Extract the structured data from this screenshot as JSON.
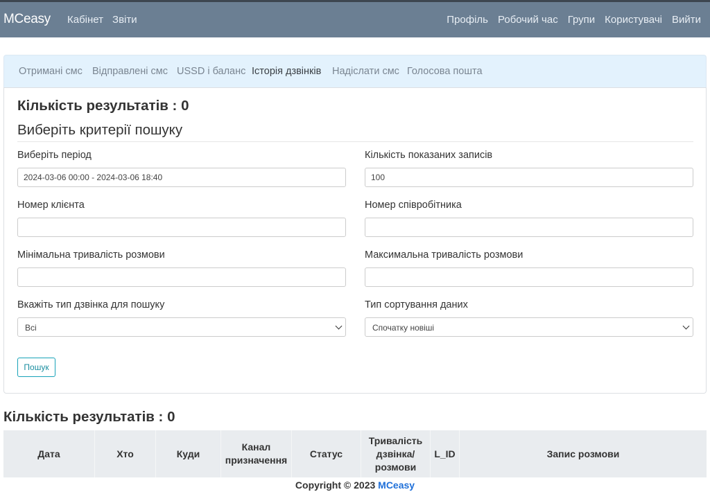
{
  "navbar": {
    "brand": "MCeasy",
    "left_links": [
      "Кабінет",
      "Звіти"
    ],
    "right_links": [
      "Профіль",
      "Робочий час",
      "Групи",
      "Користувачі",
      "Вийти"
    ]
  },
  "tabs": [
    {
      "label": "Отримані смс",
      "active": false
    },
    {
      "label": "Відправлені смс",
      "active": false
    },
    {
      "label": "USSD і баланс",
      "active": false
    },
    {
      "label": "Історія дзвінків",
      "active": true
    },
    {
      "label": "Надіслати смс",
      "active": false
    },
    {
      "label": "Голосова пошта",
      "active": false
    }
  ],
  "form": {
    "results_count": "Кількість результатів : 0",
    "criteria_title": "Виберіть критерії пошуку",
    "period_label": "Виберіть період",
    "period_value": "2024-03-06 00:00 - 2024-03-06 18:40",
    "records_label": "Кількість показаних записів",
    "records_value": "100",
    "client_label": "Номер клієнта",
    "client_value": "",
    "employee_label": "Номер співробітника",
    "employee_value": "",
    "min_duration_label": "Мінімальна тривалість розмови",
    "min_duration_value": "",
    "max_duration_label": "Максимальна тривалість розмови",
    "max_duration_value": "",
    "call_type_label": "Вкажіть тип дзвінка для пошуку",
    "call_type_value": "Всі",
    "sort_label": "Тип сортування даних",
    "sort_value": "Спочатку новіші",
    "search_button": "Пошук"
  },
  "results": {
    "count_title": "Кількість результатів : 0",
    "columns": [
      "Дата",
      "Хто",
      "Куди",
      "Канал призначення",
      "Статус",
      "Тривалість дзвінка/ розмови",
      "L_ID",
      "Запис розмови"
    ]
  },
  "footer": {
    "copyright": "Copyright © 2023",
    "brand": "MCeasy"
  },
  "colors": {
    "navbar": "#6b7f93",
    "tabs_bg": "#e3f2fd",
    "button_outline": "#17a2b8",
    "footer_brand": "#1e6fd9"
  }
}
